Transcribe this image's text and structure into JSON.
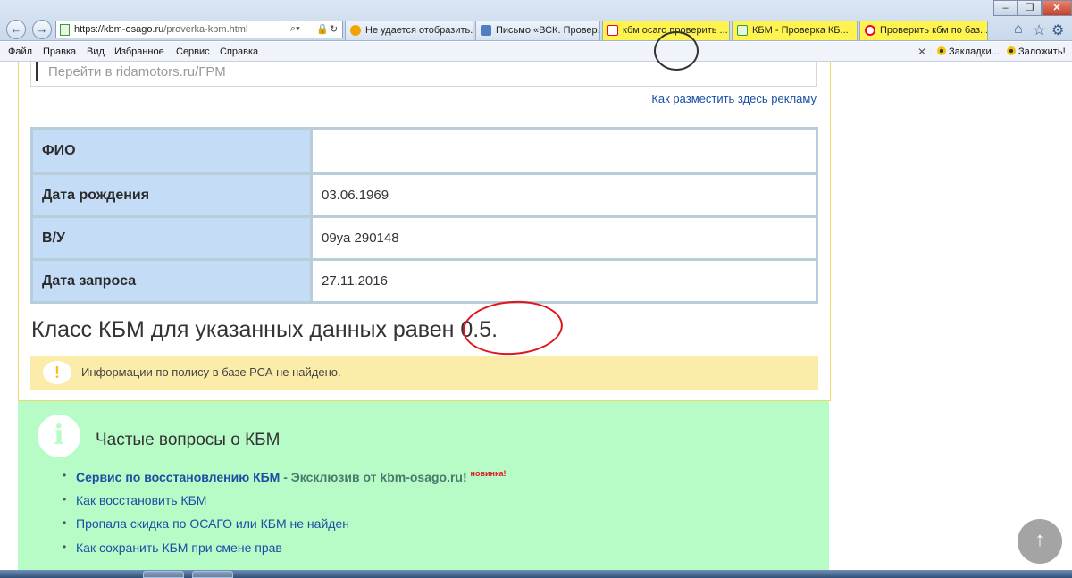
{
  "browser": {
    "url_host": "https://kbm-osago.ru",
    "url_path": "/proverka-kbm.html",
    "tabs": [
      {
        "label": "Не удается отобразить...",
        "icon": "warning-tab-icon"
      },
      {
        "label": "Письмо «ВСК. Провер...",
        "icon": "mail-tab-icon"
      },
      {
        "label": "кбм осаго проверить ...",
        "icon": "yandex-tab-icon"
      },
      {
        "label": "КБМ - Проверка КБ...",
        "icon": "page-tab-icon"
      },
      {
        "label": "Проверить кбм по баз...",
        "icon": "wheel-tab-icon"
      }
    ],
    "menu": [
      "Файл",
      "Правка",
      "Вид",
      "Избранное",
      "Сервис",
      "Справка"
    ],
    "favorites": [
      "Закладки...",
      "Заложить!"
    ]
  },
  "ad": {
    "input_placeholder": "Перейти в ridamotors.ru/ГРМ",
    "place_ad_link": "Как разместить здесь рекламу"
  },
  "table": [
    {
      "label": "ФИО",
      "value": ""
    },
    {
      "label": "Дата рождения",
      "value": "03.06.1969"
    },
    {
      "label": "В/У",
      "value": "09уа 290148"
    },
    {
      "label": "Дата запроса",
      "value": "27.11.2016"
    }
  ],
  "result": {
    "text": "Класс КБМ для указанных данных равен 0.5."
  },
  "warning": {
    "icon": "exclamation-icon",
    "text": "Информации по полису в базе РСА не найдено."
  },
  "faq": {
    "icon": "info-icon",
    "title": "Частые вопросы о КБМ",
    "items": [
      {
        "strong": "Сервис по восстановлению КБМ",
        "sep": " - ",
        "extra": "Эксклюзив от kbm-osago.ru!",
        "badge": "новинка!"
      },
      {
        "text": "Как восстановить КБМ"
      },
      {
        "text": "Пропала скидка по ОСАГО или КБМ не найден"
      },
      {
        "text": "Как сохранить КБМ при смене прав"
      }
    ]
  },
  "colors": {
    "table_label_bg": "#c5dcf7",
    "warning_bg": "#fcecaa",
    "faq_bg": "#b7fbc7",
    "link": "#1a4fa3",
    "annotation_red": "#e0161c"
  }
}
